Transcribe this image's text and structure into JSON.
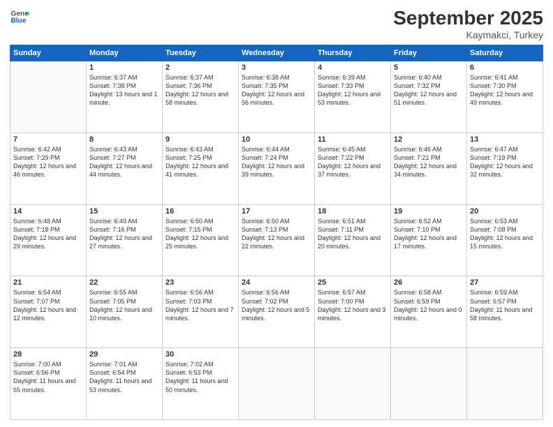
{
  "logo": {
    "line1": "General",
    "line2": "Blue"
  },
  "title": "September 2025",
  "subtitle": "Kaymakci, Turkey",
  "days_header": [
    "Sunday",
    "Monday",
    "Tuesday",
    "Wednesday",
    "Thursday",
    "Friday",
    "Saturday"
  ],
  "weeks": [
    [
      {
        "day": "",
        "sunrise": "",
        "sunset": "",
        "daylight": "",
        "empty": true
      },
      {
        "day": "1",
        "sunrise": "Sunrise: 6:37 AM",
        "sunset": "Sunset: 7:38 PM",
        "daylight": "Daylight: 13 hours and 1 minute."
      },
      {
        "day": "2",
        "sunrise": "Sunrise: 6:37 AM",
        "sunset": "Sunset: 7:36 PM",
        "daylight": "Daylight: 12 hours and 58 minutes."
      },
      {
        "day": "3",
        "sunrise": "Sunrise: 6:38 AM",
        "sunset": "Sunset: 7:35 PM",
        "daylight": "Daylight: 12 hours and 56 minutes."
      },
      {
        "day": "4",
        "sunrise": "Sunrise: 6:39 AM",
        "sunset": "Sunset: 7:33 PM",
        "daylight": "Daylight: 12 hours and 53 minutes."
      },
      {
        "day": "5",
        "sunrise": "Sunrise: 6:40 AM",
        "sunset": "Sunset: 7:32 PM",
        "daylight": "Daylight: 12 hours and 51 minutes."
      },
      {
        "day": "6",
        "sunrise": "Sunrise: 6:41 AM",
        "sunset": "Sunset: 7:30 PM",
        "daylight": "Daylight: 12 hours and 49 minutes."
      }
    ],
    [
      {
        "day": "7",
        "sunrise": "Sunrise: 6:42 AM",
        "sunset": "Sunset: 7:29 PM",
        "daylight": "Daylight: 12 hours and 46 minutes."
      },
      {
        "day": "8",
        "sunrise": "Sunrise: 6:43 AM",
        "sunset": "Sunset: 7:27 PM",
        "daylight": "Daylight: 12 hours and 44 minutes."
      },
      {
        "day": "9",
        "sunrise": "Sunrise: 6:43 AM",
        "sunset": "Sunset: 7:25 PM",
        "daylight": "Daylight: 12 hours and 41 minutes."
      },
      {
        "day": "10",
        "sunrise": "Sunrise: 6:44 AM",
        "sunset": "Sunset: 7:24 PM",
        "daylight": "Daylight: 12 hours and 39 minutes."
      },
      {
        "day": "11",
        "sunrise": "Sunrise: 6:45 AM",
        "sunset": "Sunset: 7:22 PM",
        "daylight": "Daylight: 12 hours and 37 minutes."
      },
      {
        "day": "12",
        "sunrise": "Sunrise: 6:46 AM",
        "sunset": "Sunset: 7:21 PM",
        "daylight": "Daylight: 12 hours and 34 minutes."
      },
      {
        "day": "13",
        "sunrise": "Sunrise: 6:47 AM",
        "sunset": "Sunset: 7:19 PM",
        "daylight": "Daylight: 12 hours and 32 minutes."
      }
    ],
    [
      {
        "day": "14",
        "sunrise": "Sunrise: 6:48 AM",
        "sunset": "Sunset: 7:18 PM",
        "daylight": "Daylight: 12 hours and 29 minutes."
      },
      {
        "day": "15",
        "sunrise": "Sunrise: 6:49 AM",
        "sunset": "Sunset: 7:16 PM",
        "daylight": "Daylight: 12 hours and 27 minutes."
      },
      {
        "day": "16",
        "sunrise": "Sunrise: 6:50 AM",
        "sunset": "Sunset: 7:15 PM",
        "daylight": "Daylight: 12 hours and 25 minutes."
      },
      {
        "day": "17",
        "sunrise": "Sunrise: 6:50 AM",
        "sunset": "Sunset: 7:13 PM",
        "daylight": "Daylight: 12 hours and 22 minutes."
      },
      {
        "day": "18",
        "sunrise": "Sunrise: 6:51 AM",
        "sunset": "Sunset: 7:11 PM",
        "daylight": "Daylight: 12 hours and 20 minutes."
      },
      {
        "day": "19",
        "sunrise": "Sunrise: 6:52 AM",
        "sunset": "Sunset: 7:10 PM",
        "daylight": "Daylight: 12 hours and 17 minutes."
      },
      {
        "day": "20",
        "sunrise": "Sunrise: 6:53 AM",
        "sunset": "Sunset: 7:08 PM",
        "daylight": "Daylight: 12 hours and 15 minutes."
      }
    ],
    [
      {
        "day": "21",
        "sunrise": "Sunrise: 6:54 AM",
        "sunset": "Sunset: 7:07 PM",
        "daylight": "Daylight: 12 hours and 12 minutes."
      },
      {
        "day": "22",
        "sunrise": "Sunrise: 6:55 AM",
        "sunset": "Sunset: 7:05 PM",
        "daylight": "Daylight: 12 hours and 10 minutes."
      },
      {
        "day": "23",
        "sunrise": "Sunrise: 6:56 AM",
        "sunset": "Sunset: 7:03 PM",
        "daylight": "Daylight: 12 hours and 7 minutes."
      },
      {
        "day": "24",
        "sunrise": "Sunrise: 6:56 AM",
        "sunset": "Sunset: 7:02 PM",
        "daylight": "Daylight: 12 hours and 5 minutes."
      },
      {
        "day": "25",
        "sunrise": "Sunrise: 6:57 AM",
        "sunset": "Sunset: 7:00 PM",
        "daylight": "Daylight: 12 hours and 3 minutes."
      },
      {
        "day": "26",
        "sunrise": "Sunrise: 6:58 AM",
        "sunset": "Sunset: 6:59 PM",
        "daylight": "Daylight: 12 hours and 0 minutes."
      },
      {
        "day": "27",
        "sunrise": "Sunrise: 6:59 AM",
        "sunset": "Sunset: 6:57 PM",
        "daylight": "Daylight: 11 hours and 58 minutes."
      }
    ],
    [
      {
        "day": "28",
        "sunrise": "Sunrise: 7:00 AM",
        "sunset": "Sunset: 6:56 PM",
        "daylight": "Daylight: 11 hours and 55 minutes."
      },
      {
        "day": "29",
        "sunrise": "Sunrise: 7:01 AM",
        "sunset": "Sunset: 6:54 PM",
        "daylight": "Daylight: 11 hours and 53 minutes."
      },
      {
        "day": "30",
        "sunrise": "Sunrise: 7:02 AM",
        "sunset": "Sunset: 6:53 PM",
        "daylight": "Daylight: 11 hours and 50 minutes."
      },
      {
        "day": "",
        "sunrise": "",
        "sunset": "",
        "daylight": "",
        "empty": true
      },
      {
        "day": "",
        "sunrise": "",
        "sunset": "",
        "daylight": "",
        "empty": true
      },
      {
        "day": "",
        "sunrise": "",
        "sunset": "",
        "daylight": "",
        "empty": true
      },
      {
        "day": "",
        "sunrise": "",
        "sunset": "",
        "daylight": "",
        "empty": true
      }
    ]
  ]
}
